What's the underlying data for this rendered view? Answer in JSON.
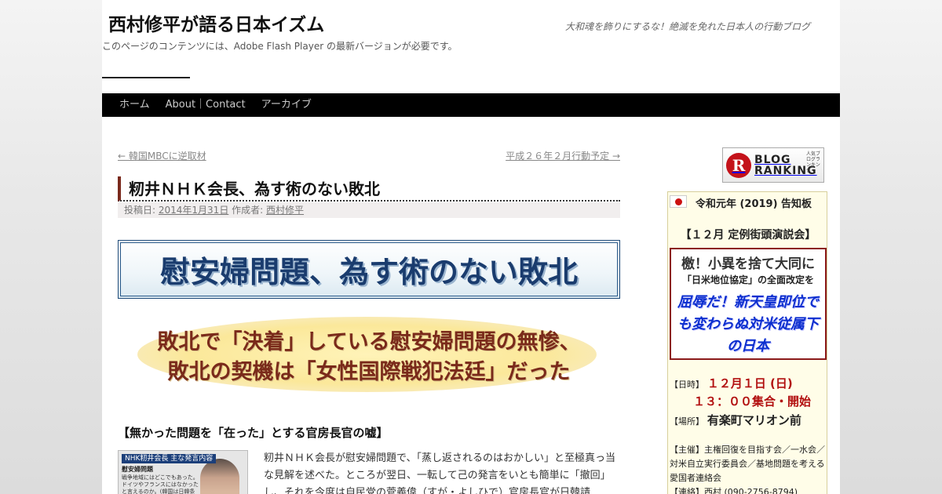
{
  "header": {
    "site_title": "西村修平が語る日本イズム",
    "site_description": "大和魂を飾りにするな！絶滅を免れた日本人の行動ブログ",
    "flash_notice": "このページのコンテンツには、Adobe Flash Player の最新バージョンが必要です。"
  },
  "nav": {
    "items": [
      "ホーム",
      "About｜Contact",
      "アーカイブ"
    ]
  },
  "post_nav": {
    "prev": "← 韓国MBCに逆取材",
    "next": "平成２６年２月行動予定 →"
  },
  "entry": {
    "title": "籾井ＮＨＫ会長、為す術のない敗北",
    "meta_posted": "投稿日:",
    "meta_date": "2014年1月31日",
    "meta_author_label": "作成者:",
    "meta_author": "西村修平",
    "banner": "慰安婦問題、為す術のない敗北",
    "subhead_line1": "敗北で「決着」している慰安婦問題の無惨、",
    "subhead_line2": "敗北の契機は「女性国際戦犯法廷」だった",
    "section_heading": "【無かった問題を「在った」とする官房長官の嘘】",
    "thumb_title": "NHK籾井会長 主な発言内容",
    "thumb_sub": "慰安婦問題",
    "thumb_text": "戦争地域にはどこでもあった。ドイツやフランスにはなかったと言えるのか。(韓国は日韓条約ですべて解",
    "body_text": "籾井ＮＨＫ会長が慰安婦問題で、「蒸し返されるのはおかしい」と至極真っ当な見解を述べた。ところが翌日、一転して己の発言をいとも簡単に「撤回」し、それを今度は自民党の菅義偉（すが・よしひで）官房長官が日韓請"
  },
  "sidebar": {
    "ranking": {
      "logo": "R",
      "line1": "BLOG",
      "line2": "RANKING",
      "small": "人気ブログランキング"
    },
    "notice": {
      "title": "令和元年 (2019) 告知板",
      "event": "【１２月 定例街頭演説会】",
      "slogan1": "檄！小異を捨て大同に",
      "slogan2": "「日米地位協定」の全面改定を",
      "slogan3": "屈辱だ！新天皇即位でも変わらぬ対米従属下の日本",
      "date_label": "【日時】",
      "date_value": "１２月１日 (日)",
      "time_value": "１３：００集合・開始",
      "place_label": "【場所】",
      "place_value": "有楽町マリオン前",
      "host_label": "【主催】",
      "host_value": "主権回復を目指す会／一水会／対米自立実行委員会／基地問題を考える愛国者連絡会",
      "contact_label": "【連絡】",
      "contact_value": "西村 (090-2756-8794)"
    }
  }
}
